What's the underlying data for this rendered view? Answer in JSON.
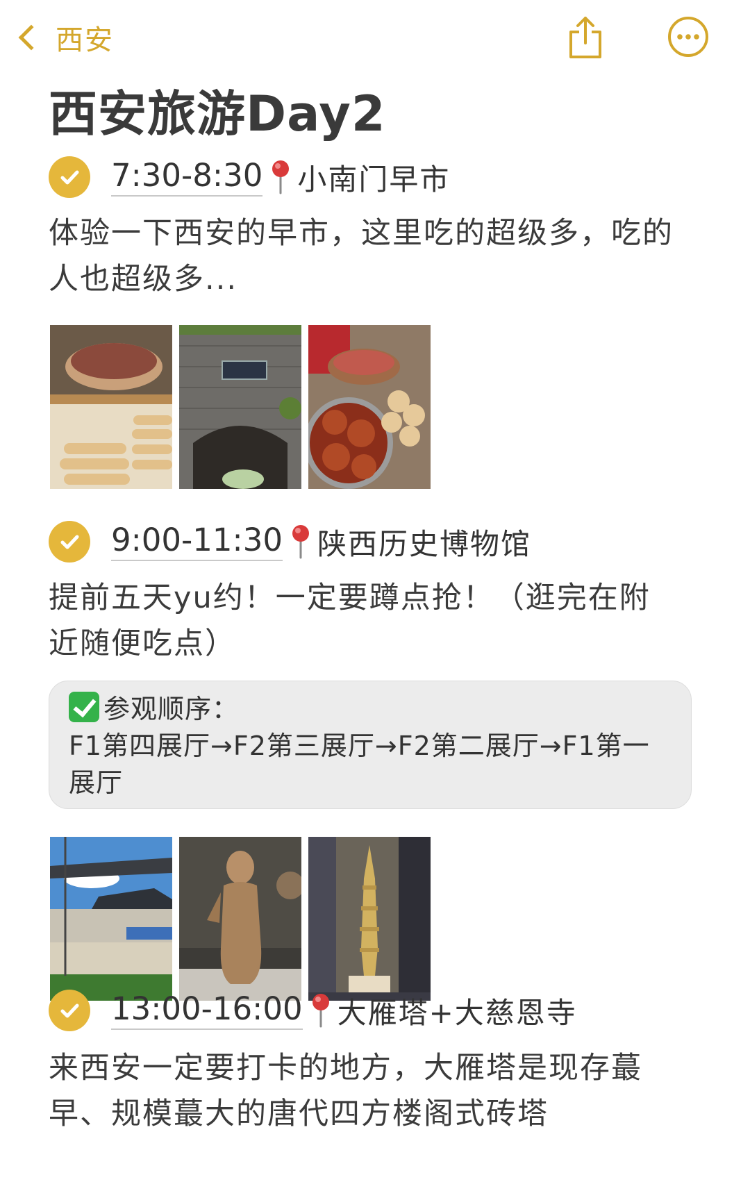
{
  "nav": {
    "back_label": "西安",
    "share_icon": "share-icon",
    "more_icon": "more-icon",
    "accent": "#D4A72C"
  },
  "title": "西安旅游Day2",
  "stops": [
    {
      "time": "7:30-8:30",
      "place": "小南门早市",
      "desc": "体验一下西安的早市，这里吃的超级多，吃的人也超级多...",
      "photos": [
        "flatbread-stall-photo",
        "city-gate-photo",
        "meat-buns-photo"
      ]
    },
    {
      "time": "9:00-11:30",
      "place": "陕西历史博物馆",
      "desc": "提前五天yu约！一定要蹲点抢！（逛完在附近随便吃点）",
      "note": {
        "heading": "参观顺序：",
        "route": "F1第四展厅→F2第三展厅→F2第二展厅→F1第一展厅"
      },
      "photos": [
        "museum-exterior-photo",
        "clay-figurine-photo",
        "golden-pagoda-photo"
      ]
    },
    {
      "time": "13:00-16:00",
      "place": "大雁塔+大慈恩寺",
      "desc": "来西安一定要打卡的地方，大雁塔是现存蕞早、规模蕞大的唐代四方楼阁式砖塔"
    }
  ],
  "colors": {
    "check": "#E5B73B",
    "note_bg": "#ececec",
    "pin": "#d93a3a"
  }
}
